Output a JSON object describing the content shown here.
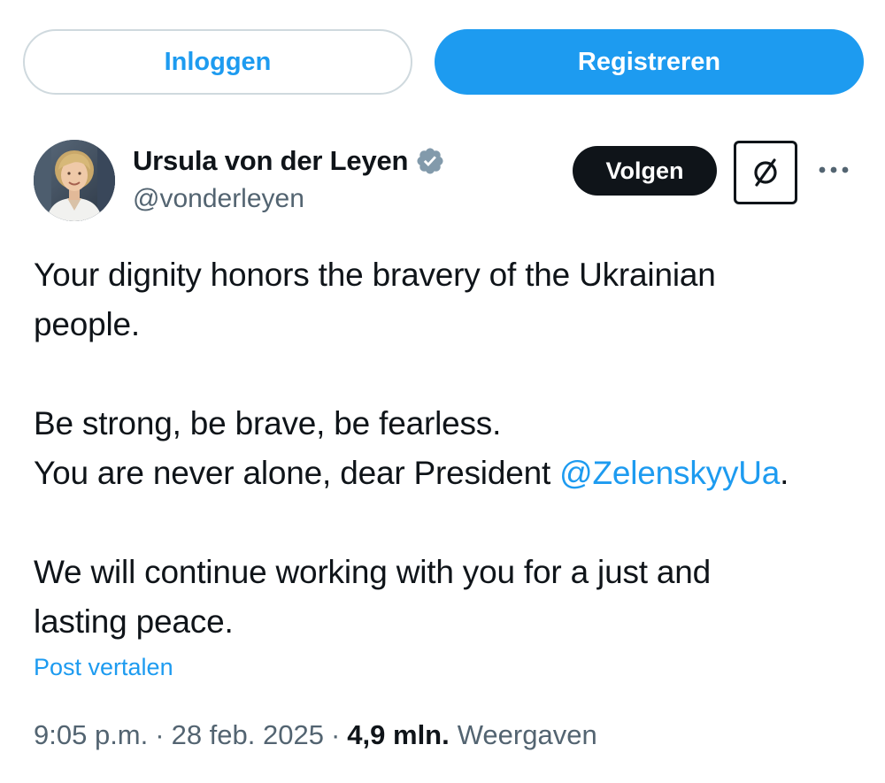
{
  "auth": {
    "login_label": "Inloggen",
    "register_label": "Registreren"
  },
  "author": {
    "name": "Ursula von der Leyen",
    "handle": "@vonderleyen",
    "verified_icon": "verified-badge-icon",
    "avatar": "avatar"
  },
  "actions": {
    "follow_label": "Volgen",
    "grok_icon": "grok-icon",
    "more_icon": "more-icon"
  },
  "post": {
    "line1": "Your dignity honors the bravery of the Ukrainian",
    "line2": "people.",
    "line3": "Be strong, be brave, be fearless.",
    "line4_prefix": "You are never alone, dear President ",
    "line4_mention": "@ZelenskyyUa",
    "line4_suffix": ".",
    "line5": "We will continue working with you for a just and",
    "line6": "lasting peace.",
    "translate_label": "Post vertalen"
  },
  "meta": {
    "time": "9:05 p.m.",
    "separator": "·",
    "date": "28 feb. 2025",
    "views_count": "4,9 mln.",
    "views_label": "Weergaven"
  },
  "colors": {
    "accent": "#1d9bf0",
    "text": "#0f1419",
    "secondary_text": "#536471",
    "border": "#cfd9de",
    "verified": "#829aab"
  }
}
